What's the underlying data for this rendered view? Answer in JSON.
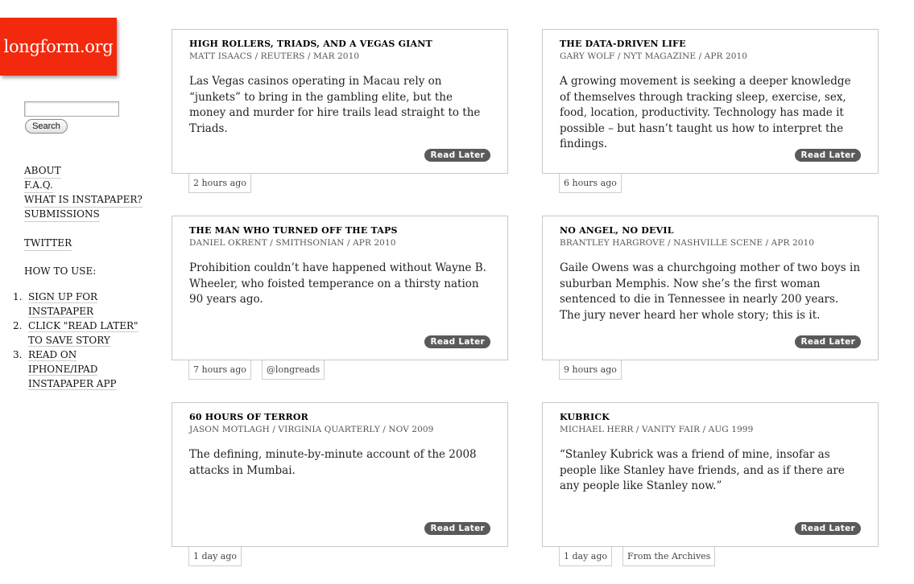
{
  "logo": {
    "text": "longform.org"
  },
  "search": {
    "placeholder": "",
    "button_label": "Search"
  },
  "nav": {
    "links": [
      "ABOUT",
      "F.A.Q.",
      "WHAT IS INSTAPAPER?",
      "SUBMISSIONS"
    ],
    "twitter": "TWITTER"
  },
  "howto": {
    "title": "HOW TO USE:",
    "steps": [
      {
        "num": "1.",
        "text": "SIGN UP FOR INSTAPAPER"
      },
      {
        "num": "2.",
        "text": "CLICK \"READ LATER\" TO SAVE STORY"
      },
      {
        "num": "3.",
        "text": "READ ON IPHONE/IPAD INSTAPAPER APP"
      }
    ]
  },
  "articles": [
    {
      "title": "HIGH ROLLERS, TRIADS, AND A VEGAS GIANT",
      "byline": "MATT ISAACS / REUTERS / MAR 2010",
      "description": "Las Vegas casinos operating in Macau rely on “junkets” to bring in the gambling elite, but the money and murder for hire trails lead straight to the Triads.",
      "read_later": "Read Later",
      "tags": [
        "2 hours ago"
      ]
    },
    {
      "title": "THE DATA-DRIVEN LIFE",
      "byline": "GARY WOLF / NYT MAGAZINE / APR 2010",
      "description": "A growing movement is seeking a deeper knowledge of themselves through tracking sleep, exercise, sex, food, location, productivity. Technology has made it possible – but hasn’t taught us how to interpret the findings.",
      "read_later": "Read Later",
      "tags": [
        "6 hours ago"
      ]
    },
    {
      "title": "THE MAN WHO TURNED OFF THE TAPS",
      "byline": "DANIEL OKRENT / SMITHSONIAN / APR 2010",
      "description": "Prohibition couldn’t have happened without Wayne B. Wheeler, who foisted temperance on a thirsty nation 90 years ago.",
      "read_later": "Read Later",
      "tags": [
        "7 hours ago",
        "@longreads"
      ]
    },
    {
      "title": "NO ANGEL, NO DEVIL",
      "byline": "BRANTLEY HARGROVE / NASHVILLE SCENE / APR 2010",
      "description": "Gaile Owens was a churchgoing mother of two boys in suburban Memphis. Now she’s the first woman sentenced to die in Tennessee in nearly 200 years. The jury never heard her whole story; this is it.",
      "read_later": "Read Later",
      "tags": [
        "9 hours ago"
      ]
    },
    {
      "title": "60 HOURS OF TERROR",
      "byline": "JASON MOTLAGH / VIRGINIA QUARTERLY / NOV 2009",
      "description": "The defining, minute-by-minute account of the 2008 attacks in Mumbai.",
      "read_later": "Read Later",
      "tags": [
        "1 day ago"
      ]
    },
    {
      "title": "KUBRICK",
      "byline": "MICHAEL HERR / VANITY FAIR / AUG 1999",
      "description": "“Stanley Kubrick was a friend of mine, insofar as people like Stanley have friends, and as if there are any people like Stanley now.”",
      "read_later": "Read Later",
      "tags": [
        "1 day ago",
        "From the Archives"
      ]
    }
  ]
}
